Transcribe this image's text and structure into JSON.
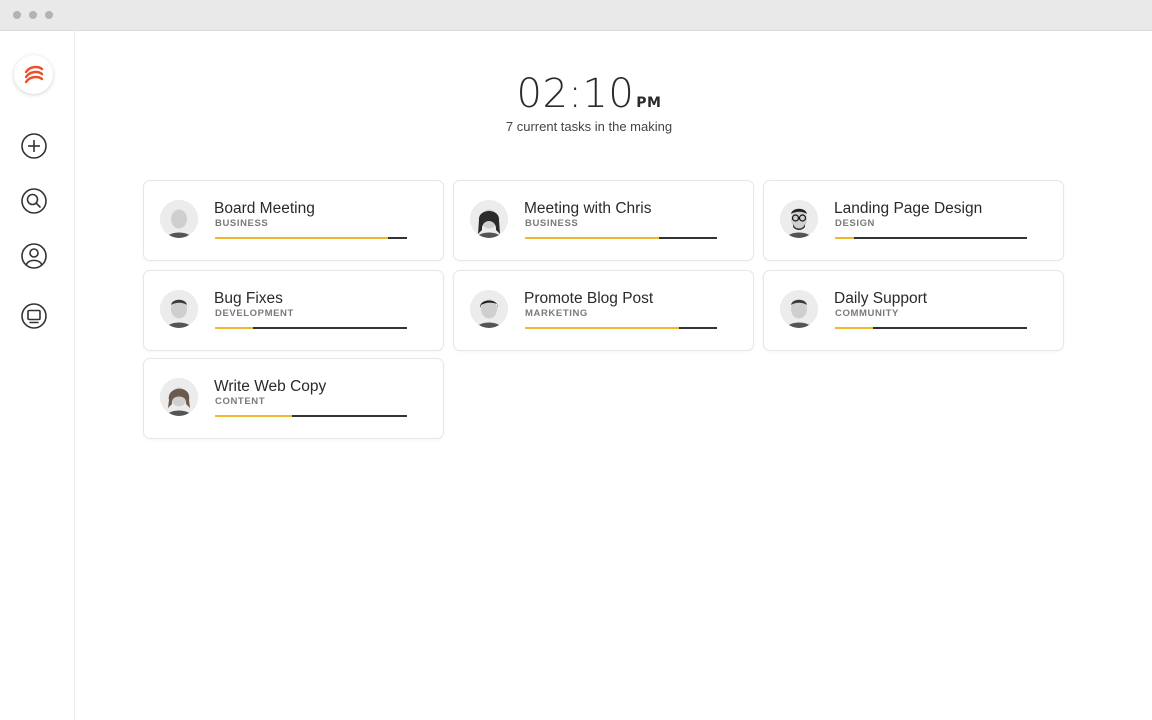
{
  "clock": {
    "time": "02:10",
    "ampm": "PM"
  },
  "subtitle": "7 current tasks in the making",
  "sidebar": {
    "items": [
      {
        "name": "add",
        "icon": "plus-circle-icon"
      },
      {
        "name": "search",
        "icon": "search-icon"
      },
      {
        "name": "profile",
        "icon": "user-icon"
      },
      {
        "name": "screen",
        "icon": "monitor-icon"
      }
    ]
  },
  "colors": {
    "accent": "#f0b82c",
    "track": "#333333",
    "brand": "#e8512a"
  },
  "tasks": [
    {
      "title": "Board Meeting",
      "category": "BUSINESS",
      "progress": 0.9,
      "hair": "bald"
    },
    {
      "title": "Meeting with Chris",
      "category": "BUSINESS",
      "progress": 0.7,
      "hair": "long"
    },
    {
      "title": "Landing Page Design",
      "category": "DESIGN",
      "progress": 0.1,
      "hair": "glasses"
    },
    {
      "title": "Bug Fixes",
      "category": "DEVELOPMENT",
      "progress": 0.2,
      "hair": "short"
    },
    {
      "title": "Promote Blog Post",
      "category": "MARKETING",
      "progress": 0.8,
      "hair": "bob"
    },
    {
      "title": "Daily Support",
      "category": "COMMUNITY",
      "progress": 0.2,
      "hair": "short"
    },
    {
      "title": "Write Web Copy",
      "category": "CONTENT",
      "progress": 0.4,
      "hair": "curly"
    }
  ]
}
